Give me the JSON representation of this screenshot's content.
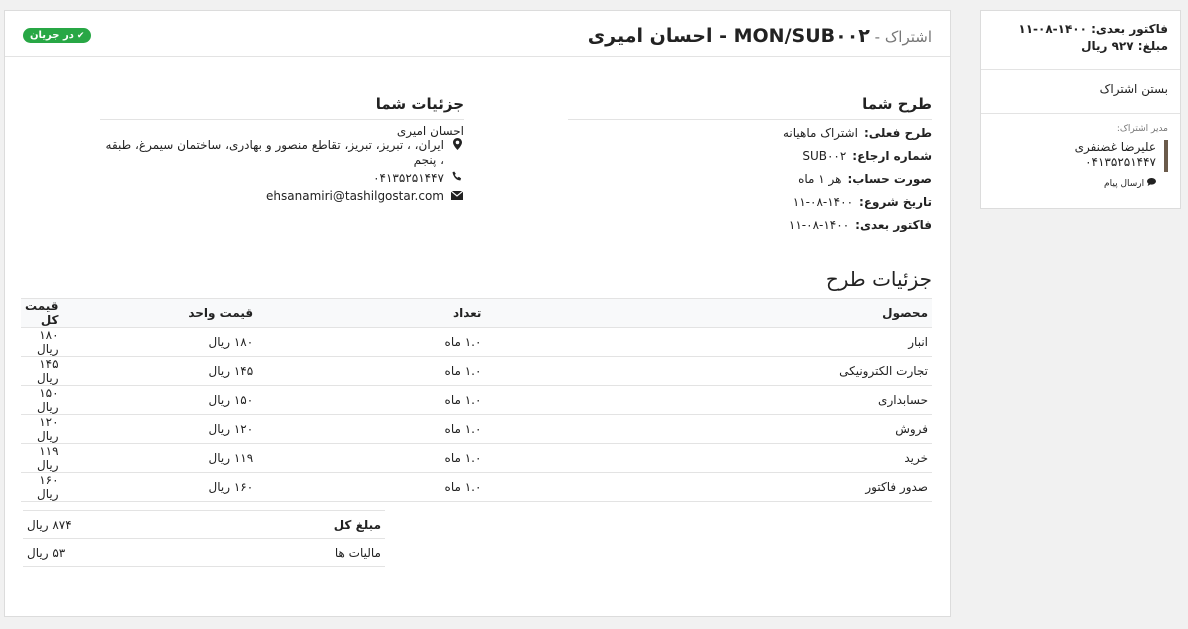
{
  "header": {
    "prefix": "اشتراک - ",
    "title": "MON/SUB۰۰۲ - احسان امیری",
    "status": "در جریان"
  },
  "plan": {
    "title": "طرح شما",
    "rows": [
      {
        "label": "طرح فعلی:",
        "value": "اشتراک ماهیانه"
      },
      {
        "label": "شماره ارجاع:",
        "value": "SUB۰۰۲"
      },
      {
        "label": "صورت حساب:",
        "value": "هر ۱ ماه"
      },
      {
        "label": "تاریخ شروع:",
        "value": "۱۴۰۰-۰۸-۱۱"
      },
      {
        "label": "فاکتور بعدی:",
        "value": "۱۴۰۰-۰۸-۱۱"
      }
    ]
  },
  "details": {
    "title": "جزئیات شما",
    "name": "احسان امیری",
    "address": "ایران، ، تبریز، تبریز، تقاطع منصور و بهادری، ساختمان سیمرغ، طبقه ، پنجم",
    "phone": "۰۴۱۳۵۲۵۱۴۴۷",
    "email": "ehsanamiri@tashilgostar.com"
  },
  "lines": {
    "title": "جزئیات طرح",
    "headers": {
      "product": "محصول",
      "qty": "تعداد",
      "unit": "قیمت واحد",
      "total": "قیمت کل"
    },
    "rows": [
      {
        "product": "انبار",
        "qty": "۱.۰ ماه",
        "unit": "۱۸۰ ریال",
        "total": "۱۸۰ ریال"
      },
      {
        "product": "تجارت الکترونیکی",
        "qty": "۱.۰ ماه",
        "unit": "۱۴۵ ریال",
        "total": "۱۴۵ ریال"
      },
      {
        "product": "حسابداری",
        "qty": "۱.۰ ماه",
        "unit": "۱۵۰ ریال",
        "total": "۱۵۰ ریال"
      },
      {
        "product": "فروش",
        "qty": "۱.۰ ماه",
        "unit": "۱۲۰ ریال",
        "total": "۱۲۰ ریال"
      },
      {
        "product": "خرید",
        "qty": "۱.۰ ماه",
        "unit": "۱۱۹ ریال",
        "total": "۱۱۹ ریال"
      },
      {
        "product": "صدور فاکتور",
        "qty": "۱.۰ ماه",
        "unit": "۱۶۰ ریال",
        "total": "۱۶۰ ریال"
      }
    ]
  },
  "totals": {
    "subtotal_label": "مبلغ کل",
    "subtotal_value": "۸۷۴ ریال",
    "tax_label": "مالیات ها",
    "tax_value": "۵۳ ریال"
  },
  "sidebar": {
    "next_invoice": "فاکتور بعدی: ۱۴۰۰-۰۸-۱۱",
    "amount": "مبلغ: ۹۲۷ ریال",
    "close": "بستن اشتراک",
    "manager_label": "مدیر اشتراک:",
    "manager_name": "علیرضا غضنفری",
    "manager_phone": "۰۴۱۳۵۲۵۱۴۴۷",
    "send_message": "ارسال پیام"
  }
}
